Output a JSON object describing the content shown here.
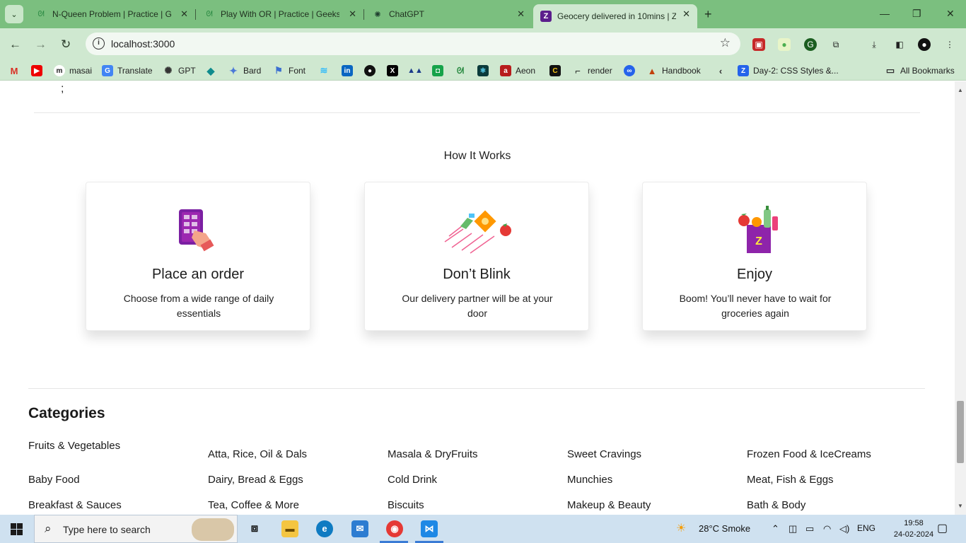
{
  "browser": {
    "tabs": [
      {
        "title": "N-Queen Problem | Practice | G",
        "close": "✕"
      },
      {
        "title": "Play With OR | Practice | Geeksf",
        "close": "✕"
      },
      {
        "title": "ChatGPT",
        "close": "✕"
      },
      {
        "title": "Geocery delivered in 10mins | Z",
        "close": "✕"
      }
    ],
    "new_tab": "+",
    "window_controls": {
      "minimize": "—",
      "restore": "❐",
      "close": "✕"
    },
    "url": "localhost:3000",
    "bookmarks": [
      "masai",
      "Translate",
      "GPT",
      "Bard",
      "Font",
      "Aeon",
      "render",
      "Handbook",
      "Day-2: CSS Styles &...",
      "All Bookmarks"
    ]
  },
  "page": {
    "stray_text": ";",
    "how_it_works": {
      "title": "How It Works",
      "cards": [
        {
          "title": "Place an order",
          "desc": "Choose from a wide range of daily essentials"
        },
        {
          "title": "Don’t Blink",
          "desc": "Our delivery partner will be at your door"
        },
        {
          "title": "Enjoy",
          "desc": "Boom! You’ll never have to wait for groceries again"
        }
      ]
    },
    "categories": {
      "title": "Categories",
      "columns": [
        [
          "Fruits & Vegetables",
          "Baby Food",
          "Breakfast & Sauces"
        ],
        [
          "Atta, Rice, Oil & Dals",
          "Dairy, Bread & Eggs",
          "Tea, Coffee & More"
        ],
        [
          "Masala & DryFruits",
          "Cold Drink",
          "Biscuits"
        ],
        [
          "Sweet Cravings",
          "Munchies",
          "Makeup & Beauty"
        ],
        [
          "Frozen Food & IceCreams",
          "Meat, Fish & Eggs",
          "Bath & Body"
        ]
      ]
    }
  },
  "taskbar": {
    "search_placeholder": "Type here to search",
    "weather": "28°C  Smoke",
    "language": "ENG",
    "time": "19:58",
    "date": "24-02-2024"
  }
}
